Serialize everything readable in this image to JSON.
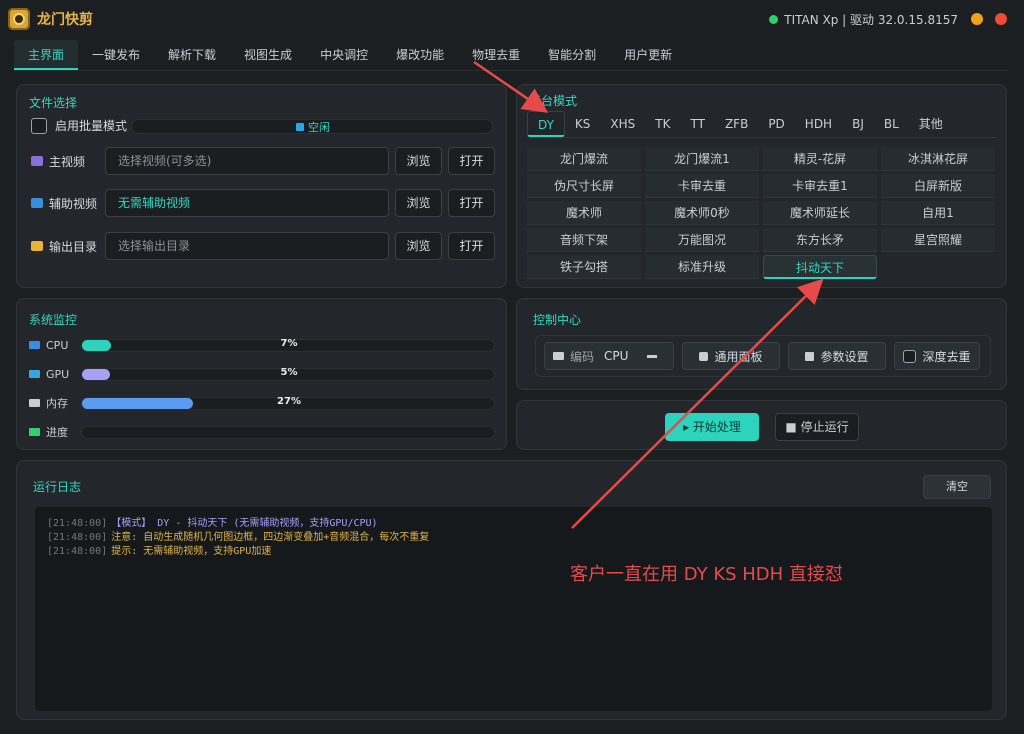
{
  "app": {
    "title": "龙门快剪",
    "status": "TITAN Xp | 驱动 32.0.15.8157"
  },
  "tabs": [
    "主界面",
    "一键发布",
    "解析下载",
    "视图生成",
    "中央调控",
    "爆改功能",
    "物理去重",
    "智能分割",
    "用户更新"
  ],
  "file_panel": {
    "title": "文件选择",
    "batch_label": "启用批量模式",
    "idle_label": "空闲",
    "rows": [
      {
        "label": "主视频",
        "placeholder": "选择视频(可多选)",
        "value": "",
        "browse": "浏览",
        "open": "打开"
      },
      {
        "label": "辅助视频",
        "placeholder": "",
        "value": "无需辅助视频",
        "browse": "浏览",
        "open": "打开"
      },
      {
        "label": "输出目录",
        "placeholder": "选择输出目录",
        "value": "",
        "browse": "浏览",
        "open": "打开"
      }
    ]
  },
  "platform_panel": {
    "title": "平台模式",
    "platforms": [
      "DY",
      "KS",
      "XHS",
      "TK",
      "TT",
      "ZFB",
      "PD",
      "HDH",
      "BJ",
      "BL",
      "其他"
    ],
    "active_platform": "DY",
    "modes": [
      "龙门爆流",
      "龙门爆流1",
      "精灵-花屏",
      "冰淇淋花屏",
      "伪尺寸长屏",
      "卡审去重",
      "卡审去重1",
      "白屏新版",
      "魔术师",
      "魔术师0秒",
      "魔术师延长",
      "自用1",
      "音频下架",
      "万能图况",
      "东方长矛",
      "星宫照耀",
      "铁子勾搭",
      "标准升级",
      "抖动天下"
    ],
    "active_mode": "抖动天下"
  },
  "monitor_panel": {
    "title": "系统监控",
    "rows": [
      {
        "label": "CPU",
        "pct_text": "7%",
        "pct": 0.07,
        "color": "#2ed3bd"
      },
      {
        "label": "GPU",
        "pct_text": "5%",
        "pct": 0.05,
        "color": "#a79ef5"
      },
      {
        "label": "内存",
        "pct_text": "27%",
        "pct": 0.27,
        "color": "#5b9cf0"
      },
      {
        "label": "进度",
        "pct_text": "",
        "pct": 0,
        "color": "#2ed3bd"
      }
    ]
  },
  "control_panel": {
    "title": "控制中心",
    "encode_label": "编码",
    "encode_value": "CPU",
    "general_panel": "通用面板",
    "params": "参数设置",
    "deep_dedup": "深度去重"
  },
  "run_panel": {
    "start": "开始处理",
    "stop": "停止运行"
  },
  "log_panel": {
    "title": "运行日志",
    "clear": "清空",
    "lines": [
      {
        "ts": "[21:48:00]",
        "text": "【模式】 DY - 抖动天下 (无需辅助视频，支持GPU/CPU)",
        "color": "a"
      },
      {
        "ts": "[21:48:00]",
        "text": "注意: 自动生成随机几何图边框，四边渐变叠加+音频混合，每次不重复",
        "color": "b"
      },
      {
        "ts": "[21:48:00]",
        "text": "提示: 无需辅助视频，支持GPU加速",
        "color": "b"
      }
    ]
  },
  "annotation": {
    "text": "客户一直在用 DY  KS HDH 直接怼",
    "color": "#e84a4a"
  }
}
